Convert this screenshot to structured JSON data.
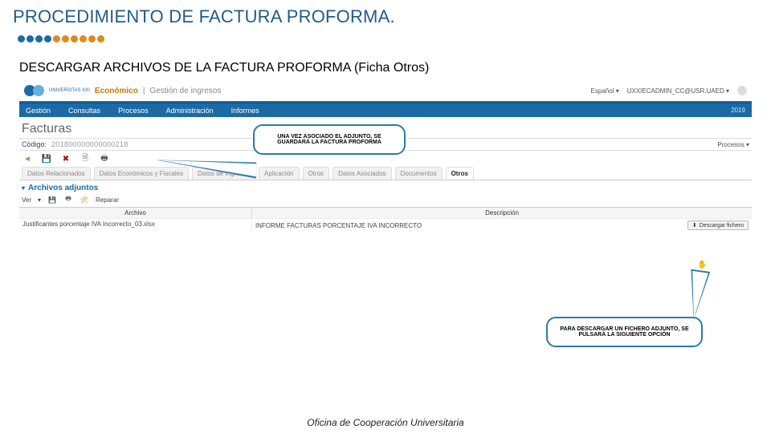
{
  "slide": {
    "title": "PROCEDIMIENTO DE FACTURA PROFORMA.",
    "subtitle": "DESCARGAR ARCHIVOS DE LA FACTURA PROFORMA (Ficha Otros)",
    "footer": "Oficina de Cooperación Universitaria",
    "dots": [
      "#1b6aa5",
      "#1b6aa5",
      "#1b6aa5",
      "#1b6aa5",
      "#e08a1c",
      "#e08a1c",
      "#e08a1c",
      "#e08a1c",
      "#e08a1c",
      "#e08a1c"
    ]
  },
  "header": {
    "brand_sub": "UNIVERSITAS XXI",
    "module": "Económico",
    "section": "Gestión de ingresos",
    "lang": "Español",
    "user": "UXXIECADMIN_CC@USR.UAED",
    "year": "2019"
  },
  "menu": [
    "Gestión",
    "Consultas",
    "Procesos",
    "Administración",
    "Informes"
  ],
  "page_heading": "Facturas",
  "codigo": {
    "label": "Código:",
    "value": "201800000000000218"
  },
  "procesos_label": "Procesos",
  "tabs": [
    "Datos Relacionados",
    "Datos Económicos y Fiscales",
    "Datos de Ingresos",
    "Aplicación",
    "Otros",
    "Datos Asociados",
    "Documentos",
    "Otros"
  ],
  "tabs_active_index": 7,
  "panel": {
    "title": "Archivos adjuntos",
    "ver_label": "Ver",
    "reparar_label": "Reparar"
  },
  "grid": {
    "col_archivo": "Archivo",
    "col_descripcion": "Descripción",
    "row": {
      "archivo": "Justificantes porcentaje IVA Incorrecto_03.xlsx",
      "descripcion": "INFORME FACTURAS PORCENTAJE IVA INCORRECTO",
      "descargar_label": "Descargar fichero"
    }
  },
  "callouts": {
    "top": "UNA VEZ ASOCIADO EL ADJUNTO, SE GUARDARÁ LA FACTURA PROFORMA",
    "bottom": "PARA DESCARGAR UN FICHERO ADJUNTO, SE PULSARÁ LA SIGUIENTE OPCIÓN"
  },
  "icons": {
    "arrow_left": "◄",
    "save": "💾",
    "delete": "✖",
    "doc": "🗎",
    "print": "🖶",
    "reparar": "🛠",
    "download": "⬇",
    "dropdown": "▾",
    "chevron": "▾",
    "cursor": "✋"
  }
}
